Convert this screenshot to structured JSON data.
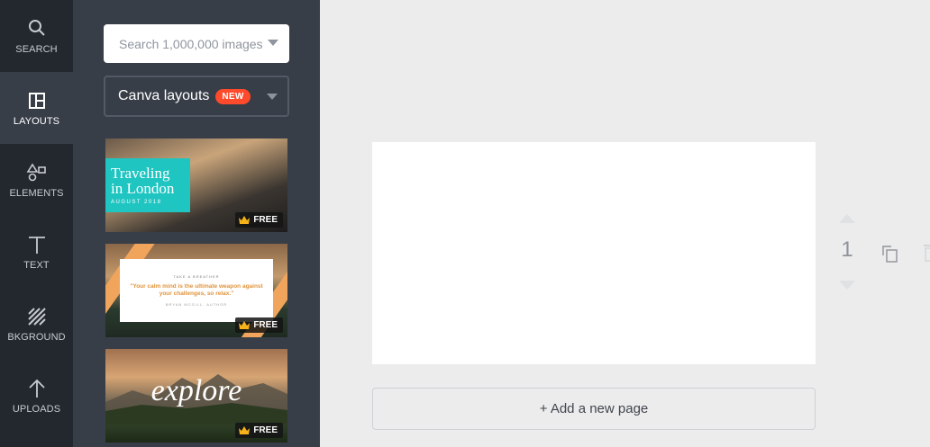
{
  "rail": {
    "items": [
      {
        "label": "SEARCH",
        "icon": "search-icon"
      },
      {
        "label": "LAYOUTS",
        "icon": "layouts-icon",
        "active": true
      },
      {
        "label": "ELEMENTS",
        "icon": "elements-icon"
      },
      {
        "label": "TEXT",
        "icon": "text-icon"
      },
      {
        "label": "BKGROUND",
        "icon": "background-icon"
      },
      {
        "label": "UPLOADS",
        "icon": "upload-icon"
      }
    ]
  },
  "panel": {
    "search_placeholder": "Search 1,000,000 images",
    "layout_select": {
      "label": "Canva layouts",
      "badge": "NEW"
    },
    "thumbnails": [
      {
        "title": "Traveling in London",
        "subtitle": "AUGUST 2018",
        "tag": "FREE"
      },
      {
        "kicker": "TAKE A BREATHER",
        "quote": "\"Your calm mind is the ultimate weapon against your challenges, so relax.\"",
        "author": "BRYAN MCGILL, AUTHOR",
        "tag": "FREE"
      },
      {
        "title": "explore",
        "tag": "FREE"
      }
    ]
  },
  "editor": {
    "page_number": "1",
    "add_page_label": "+ Add a new page"
  },
  "colors": {
    "rail_bg": "#23272e",
    "panel_bg": "#383e48",
    "badge": "#ff4a2c",
    "workspace_bg": "#ececed"
  }
}
